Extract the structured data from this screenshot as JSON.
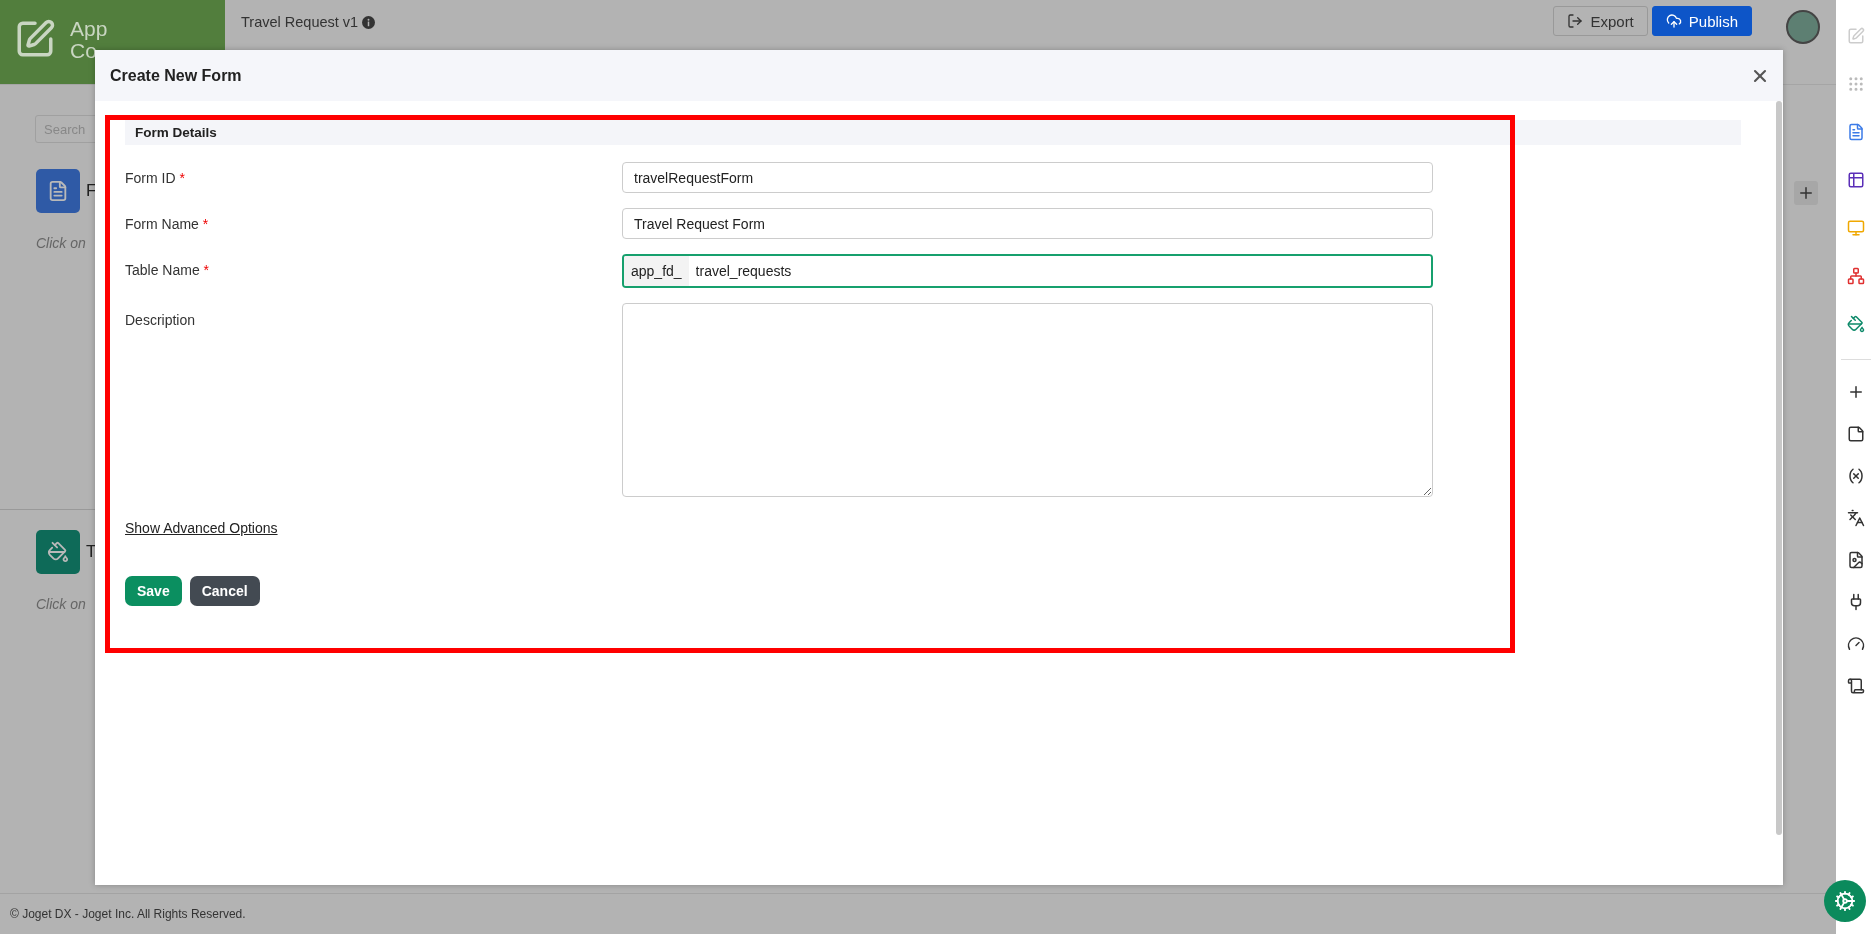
{
  "header": {
    "logo_lines": [
      "App",
      "Co"
    ],
    "app_title": "Travel Request v1",
    "buttons": [
      {
        "label": "Export",
        "kind": "outline"
      },
      {
        "label": "Publish",
        "kind": "primary"
      }
    ]
  },
  "left_panel": {
    "search": {
      "placeholder": "Search"
    },
    "sections": [
      {
        "kind": "form",
        "title": "F",
        "hint": "Click on"
      },
      {
        "kind": "theme",
        "title": "T",
        "hint": "Click on"
      }
    ]
  },
  "dialog": {
    "title": "Create New Form",
    "section": "Form Details",
    "fields": [
      {
        "kind": "text",
        "label": "Form ID",
        "required_mark": "*",
        "value": "travelRequestForm",
        "focused": false
      },
      {
        "kind": "text",
        "label": "Form Name",
        "required_mark": "*",
        "value": "Travel Request Form",
        "focused": false
      },
      {
        "kind": "prefixed",
        "label": "Table Name",
        "required_mark": "*",
        "prefix": "app_fd_",
        "value": "travel_requests",
        "focused": true
      },
      {
        "kind": "textarea",
        "label": "Description",
        "focused": false
      }
    ],
    "link": "Show Advanced Options",
    "buttons": [
      {
        "label": "Save",
        "kind": "primary"
      },
      {
        "label": "Cancel",
        "kind": "secondary"
      }
    ]
  },
  "footer": "© Joget DX - Joget Inc. All Rights Reserved."
}
